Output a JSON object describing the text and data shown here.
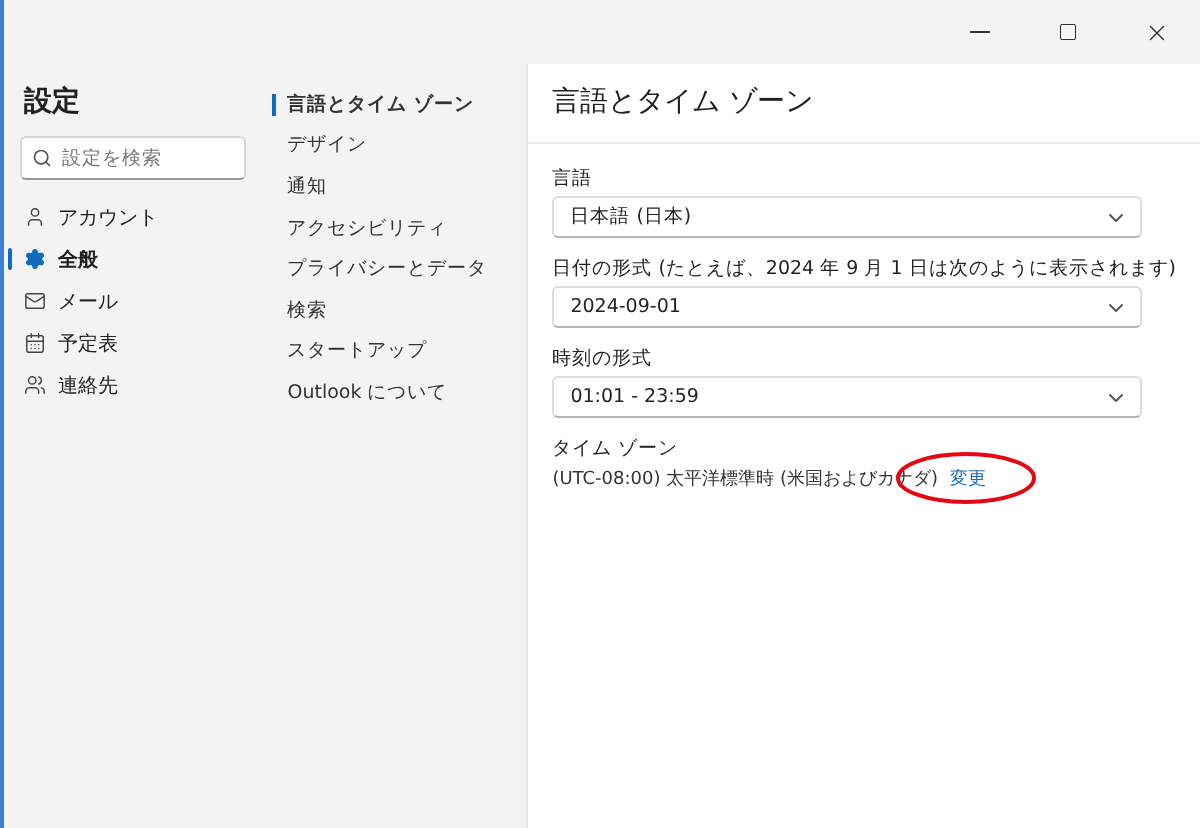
{
  "sidebar": {
    "title": "設定",
    "search": {
      "placeholder": "設定を検索"
    },
    "items": [
      {
        "label": "アカウント",
        "selected": false
      },
      {
        "label": "全般",
        "selected": true
      },
      {
        "label": "メール",
        "selected": false
      },
      {
        "label": "予定表",
        "selected": false
      },
      {
        "label": "連絡先",
        "selected": false
      }
    ]
  },
  "subnav": {
    "items": [
      {
        "label": "言語とタイム ゾーン",
        "selected": true
      },
      {
        "label": "デザイン",
        "selected": false
      },
      {
        "label": "通知",
        "selected": false
      },
      {
        "label": "アクセシビリティ",
        "selected": false
      },
      {
        "label": "プライバシーとデータ",
        "selected": false
      },
      {
        "label": "検索",
        "selected": false
      },
      {
        "label": "スタートアップ",
        "selected": false
      },
      {
        "label": "Outlook について",
        "selected": false
      }
    ]
  },
  "content": {
    "title": "言語とタイム ゾーン",
    "fields": [
      {
        "label": "言語",
        "value": "日本語 (日本)"
      },
      {
        "label": "日付の形式 (たとえば、2024 年 9 月 1 日は次のように表示されます)",
        "value": "2024-09-01"
      },
      {
        "label": "時刻の形式",
        "value": "01:01 - 23:59"
      }
    ],
    "timezone": {
      "label": "タイム ゾーン",
      "value": "(UTC-08:00) 太平洋標準時 (米国およびカナダ)",
      "link": "変更",
      "link_circled": true
    }
  }
}
